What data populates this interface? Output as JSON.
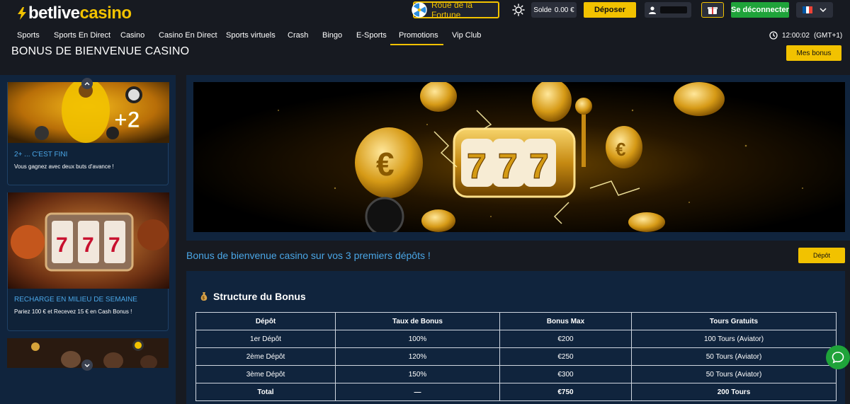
{
  "header": {
    "logo_bet": "betlive",
    "logo_casino": "casino",
    "wheel_label": "Roue de la Fortune",
    "balance_label": "Solde",
    "balance_value": "0.00 €",
    "deposit_label": "Déposer",
    "logout_label": "Se déconnecter",
    "language": "FR",
    "icons": [
      "bolt-icon",
      "wheel-icon",
      "sun-icon",
      "user-icon",
      "gift-icon",
      "chevron-down-icon",
      "france-flag-icon"
    ]
  },
  "nav": {
    "items": [
      "Sports",
      "Sports En Direct",
      "Casino",
      "Casino En Direct",
      "Sports virtuels",
      "Crash",
      "Bingo",
      "E-Sports",
      "Promotions",
      "Vip Club"
    ],
    "active": "Promotions",
    "time": "12:00:02",
    "timezone": "(GMT+1)"
  },
  "page": {
    "title": "BONUS DE BIENVENUE CASINO",
    "my_bonus_label": "Mes bonus",
    "subtitle": "Bonus de bienvenue casino sur vos 3 premiers dépôts !",
    "deposit_button": "Dépôt"
  },
  "sidebar": {
    "cards": [
      {
        "title": "2+ ... C'EST FINI",
        "description": "Vous gagnez avec deux buts d'avance !"
      },
      {
        "title": "RECHARGE EN MILIEU DE SEMAINE",
        "description": "Pariez 100 € et Recevez 15 € en Cash Bonus !"
      },
      {
        "title": "",
        "description": ""
      }
    ]
  },
  "structure": {
    "title": "Structure du Bonus",
    "headers": [
      "Dépôt",
      "Taux de Bonus",
      "Bonus Max",
      "Tours Gratuits"
    ],
    "rows": [
      [
        "1er Dépôt",
        "100%",
        "€200",
        "100 Tours (Aviator)"
      ],
      [
        "2ème Dépôt",
        "120%",
        "€250",
        "50 Tours (Aviator)"
      ],
      [
        "3ème Dépôt",
        "150%",
        "€300",
        "50 Tours (Aviator)"
      ]
    ],
    "total": [
      "Total",
      "—",
      "€750",
      "200 Tours"
    ]
  },
  "colors": {
    "accent": "#f2c200",
    "link": "#4aa6e6",
    "success": "#1fa33a",
    "panel": "#10243d",
    "background": "#171a21"
  }
}
